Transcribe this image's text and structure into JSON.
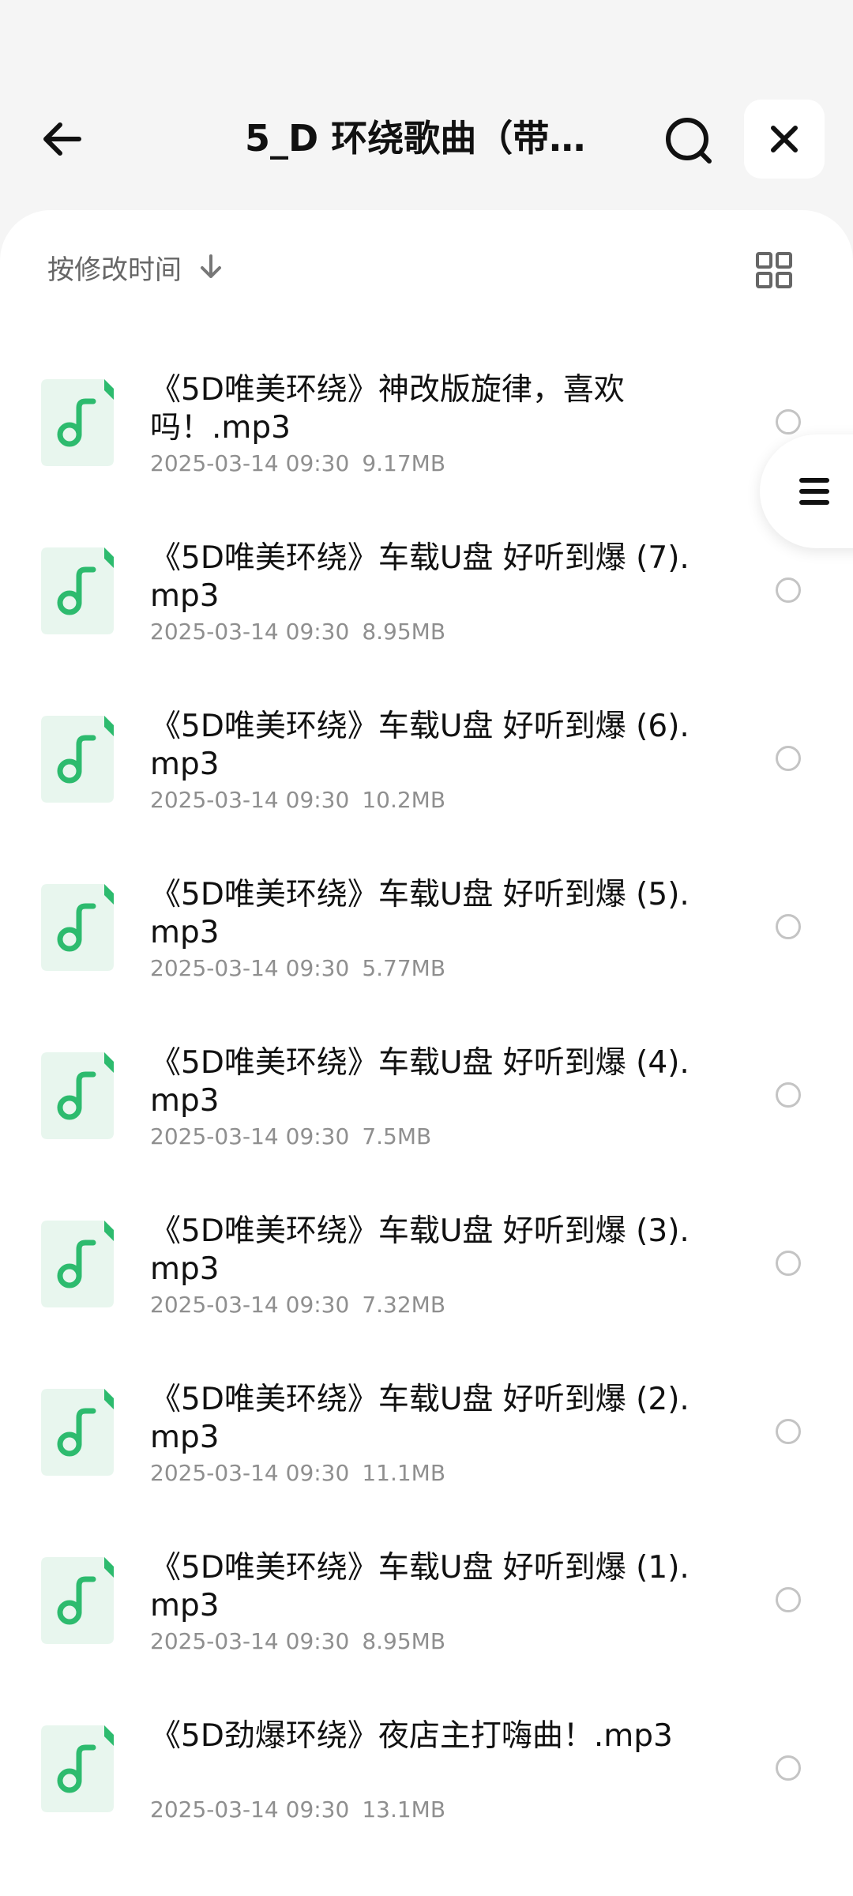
{
  "header": {
    "title": "5_D 环绕歌曲（带…",
    "back_icon": "arrow-left-icon",
    "search_icon": "search-icon",
    "close_icon": "close-icon"
  },
  "sort": {
    "label": "按修改时间",
    "direction_icon": "arrow-down-icon",
    "view_icon": "grid-view-icon"
  },
  "side_handle": {
    "icon": "menu-lines-icon"
  },
  "colors": {
    "accent_green": "#2dbb6e",
    "icon_bg": "#e8f6ee"
  },
  "files": [
    {
      "name": "《5D唯美环绕》神改版旋律，喜欢吗！.mp3",
      "date": "2025-03-14 09:30",
      "size": "9.17MB"
    },
    {
      "name": "《5D唯美环绕》车载U盘 好听到爆 (7).mp3",
      "date": "2025-03-14 09:30",
      "size": "8.95MB"
    },
    {
      "name": "《5D唯美环绕》车载U盘 好听到爆 (6).mp3",
      "date": "2025-03-14 09:30",
      "size": "10.2MB"
    },
    {
      "name": "《5D唯美环绕》车载U盘 好听到爆 (5).mp3",
      "date": "2025-03-14 09:30",
      "size": "5.77MB"
    },
    {
      "name": "《5D唯美环绕》车载U盘 好听到爆 (4).mp3",
      "date": "2025-03-14 09:30",
      "size": "7.5MB"
    },
    {
      "name": "《5D唯美环绕》车载U盘 好听到爆 (3).mp3",
      "date": "2025-03-14 09:30",
      "size": "7.32MB"
    },
    {
      "name": "《5D唯美环绕》车载U盘 好听到爆 (2).mp3",
      "date": "2025-03-14 09:30",
      "size": "11.1MB"
    },
    {
      "name": "《5D唯美环绕》车载U盘 好听到爆 (1).mp3",
      "date": "2025-03-14 09:30",
      "size": "8.95MB"
    },
    {
      "name": "《5D劲爆环绕》夜店主打嗨曲！.mp3",
      "date": "2025-03-14 09:30",
      "size": "13.1MB"
    }
  ]
}
